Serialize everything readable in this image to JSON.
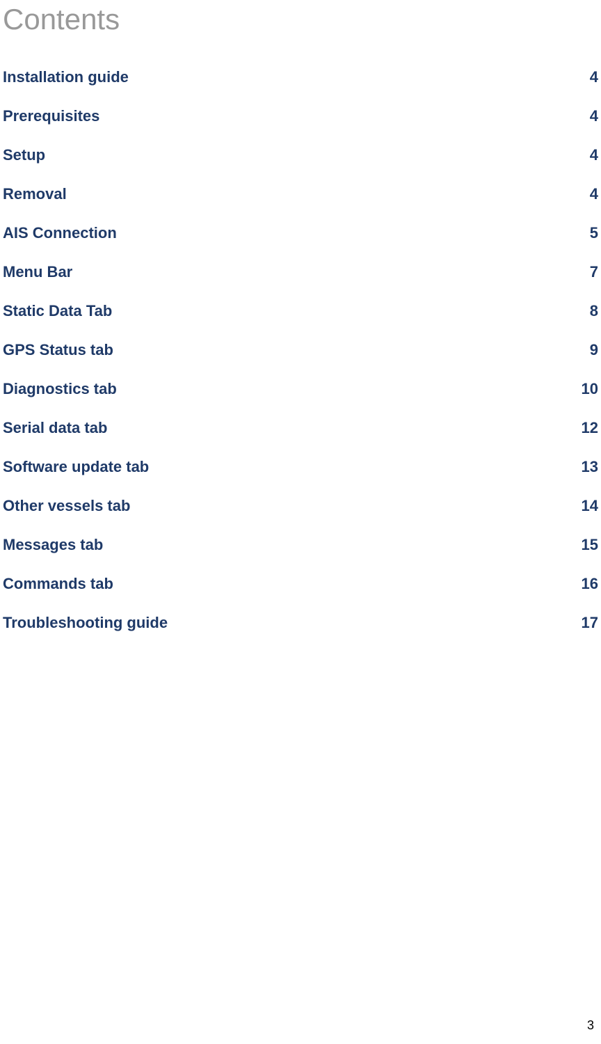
{
  "title": "Contents",
  "toc": {
    "entries": [
      {
        "title": "Installation guide",
        "page": "4"
      },
      {
        "title": "Prerequisites",
        "page": "4"
      },
      {
        "title": "Setup",
        "page": "4"
      },
      {
        "title": "Removal",
        "page": "4"
      },
      {
        "title": "AIS Connection",
        "page": "5"
      },
      {
        "title": "Menu Bar",
        "page": "7"
      },
      {
        "title": "Static Data Tab",
        "page": "8"
      },
      {
        "title": "GPS Status tab",
        "page": "9"
      },
      {
        "title": "Diagnostics tab",
        "page": "10"
      },
      {
        "title": "Serial data tab",
        "page": "12"
      },
      {
        "title": "Software update tab",
        "page": "13"
      },
      {
        "title": "Other vessels tab",
        "page": "14"
      },
      {
        "title": "Messages tab",
        "page": "15"
      },
      {
        "title": "Commands tab",
        "page": "16"
      },
      {
        "title": "Troubleshooting guide",
        "page": "17"
      }
    ]
  },
  "page_number": "3"
}
